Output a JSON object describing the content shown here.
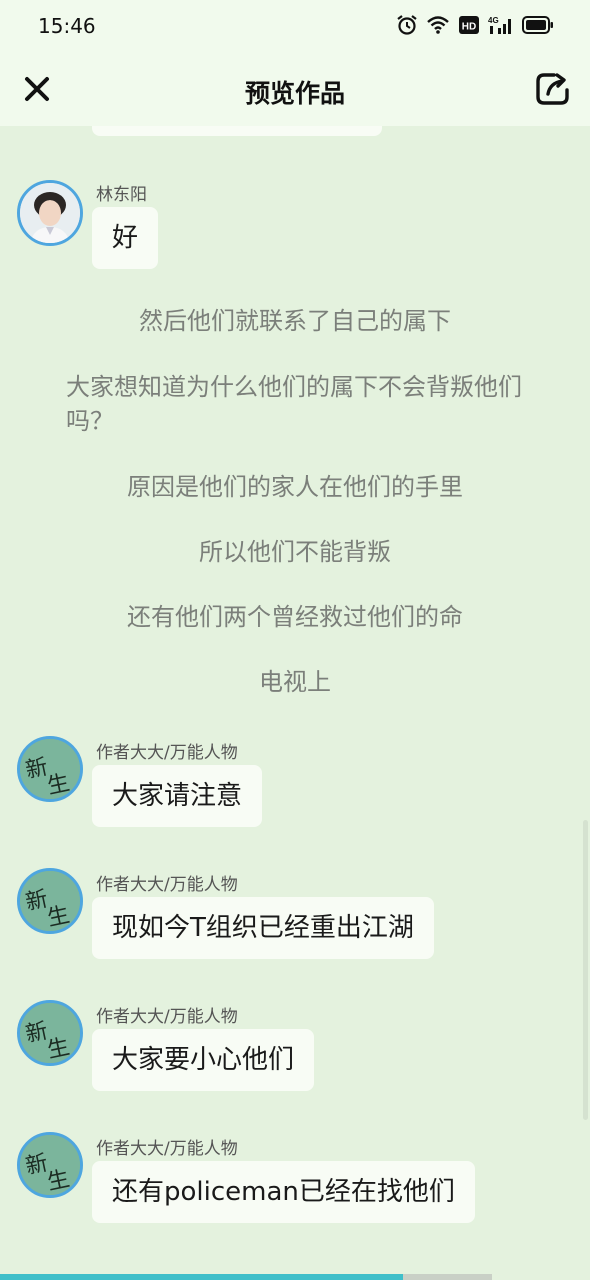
{
  "status_bar": {
    "time": "15:46",
    "icons": [
      "alarm-icon",
      "wifi-icon",
      "hd-icon",
      "signal-4g-icon",
      "battery-icon"
    ],
    "network_label": "HD",
    "signal_label": "4G"
  },
  "nav": {
    "title": "预览作品",
    "close_icon": "close-icon",
    "share_icon": "share-icon"
  },
  "messages": [
    {
      "type": "dialogue",
      "speaker": "林东阳",
      "text": "好",
      "avatar": "photo"
    },
    {
      "type": "narration",
      "text": "然后他们就联系了自己的属下"
    },
    {
      "type": "narration",
      "text": "大家想知道为什么他们的属下不会背叛他们吗？"
    },
    {
      "type": "narration",
      "text": "原因是他们的家人在他们的手里"
    },
    {
      "type": "narration",
      "text": "所以他们不能背叛"
    },
    {
      "type": "narration",
      "text": "还有他们两个曾经救过他们的命"
    },
    {
      "type": "narration",
      "text": "电视上"
    },
    {
      "type": "dialogue",
      "speaker": "作者大大/万能人物",
      "text": "大家请注意",
      "avatar": "新生"
    },
    {
      "type": "dialogue",
      "speaker": "作者大大/万能人物",
      "text": "现如今T组织已经重出江湖",
      "avatar": "新生"
    },
    {
      "type": "dialogue",
      "speaker": "作者大大/万能人物",
      "text": "大家要小心他们",
      "avatar": "新生"
    },
    {
      "type": "dialogue",
      "speaker": "作者大大/万能人物",
      "text": "还有policeman已经在找他们",
      "avatar": "新生"
    }
  ],
  "progress": {
    "fraction": 0.82
  },
  "colors": {
    "background": "#e4f2de",
    "header": "#f1faed",
    "bubble": "#f8fcf5",
    "avatar_border": "#4ea6df",
    "progress": "#3fbfc9"
  }
}
